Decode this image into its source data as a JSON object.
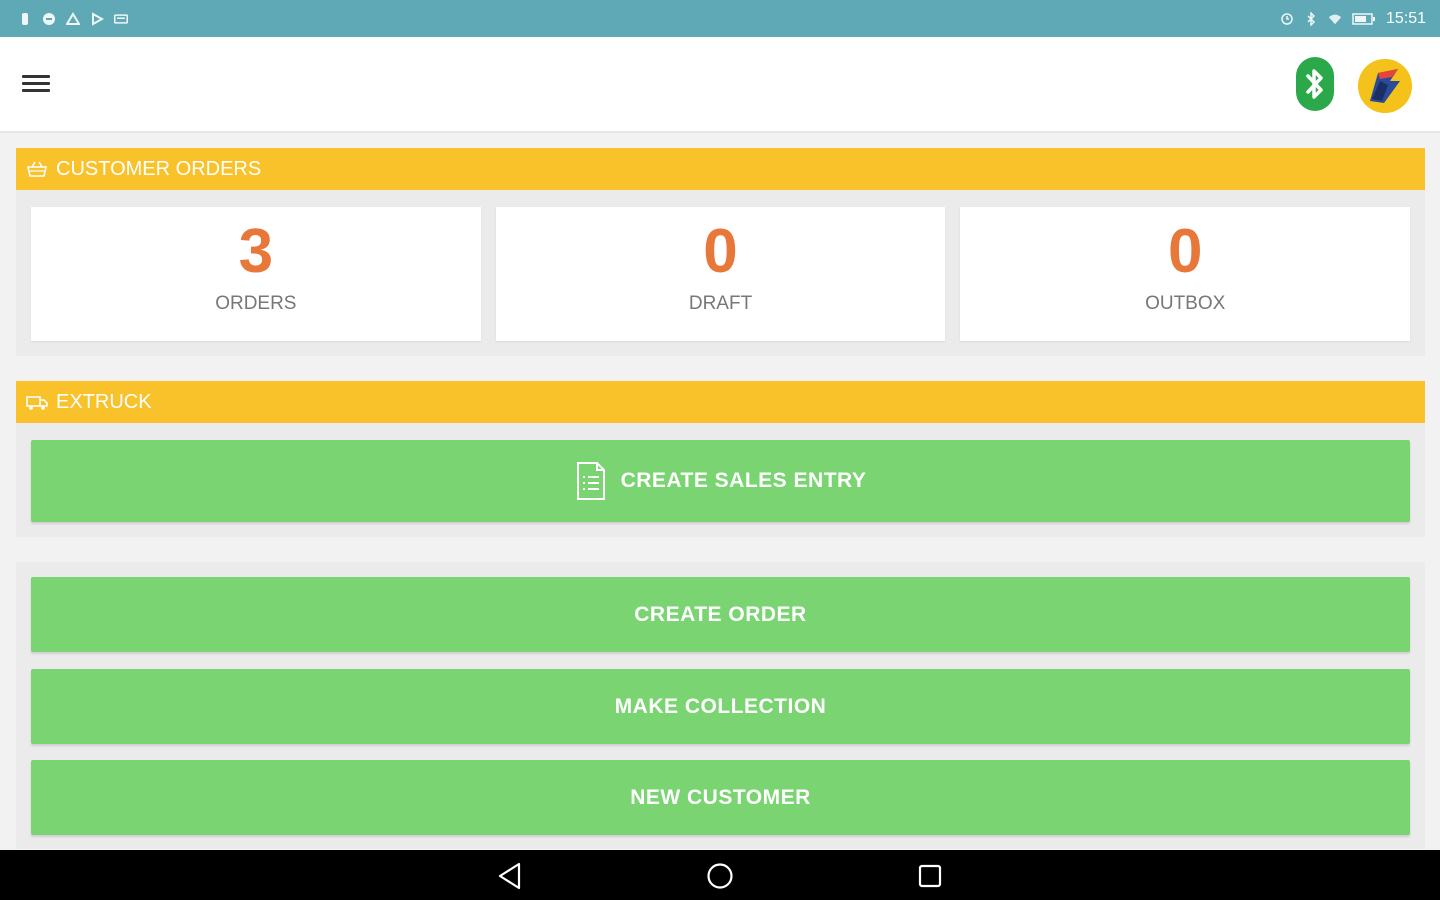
{
  "status_bar": {
    "time": "15:51",
    "left_icons": [
      "sim-icon",
      "message-icon",
      "triangle-icon",
      "play-icon",
      "keyboard-icon"
    ],
    "right_icons": [
      "alarm-icon",
      "bluetooth-icon",
      "wifi-icon",
      "battery-icon"
    ]
  },
  "app_bar": {
    "icons": [
      "menu-icon",
      "bluetooth-icon",
      "avatar"
    ],
    "bluetooth_color": "#2aa84a"
  },
  "customer_orders": {
    "title": "CUSTOMER ORDERS",
    "icon": "basket-icon",
    "stats": [
      {
        "value": "3",
        "label": "ORDERS"
      },
      {
        "value": "0",
        "label": "DRAFT"
      },
      {
        "value": "0",
        "label": "OUTBOX"
      }
    ]
  },
  "extruck": {
    "title": "EXTRUCK",
    "icon": "truck-icon",
    "create_sales_entry": "CREATE SALES ENTRY"
  },
  "actions": {
    "create_order": "CREATE ORDER",
    "make_collection": "MAKE COLLECTION",
    "new_customer": "NEW CUSTOMER"
  },
  "colors": {
    "status_bar": "#5ea9b5",
    "section_header": "#f9c12a",
    "button_green": "#7ad472",
    "stat_orange": "#e8773a"
  }
}
